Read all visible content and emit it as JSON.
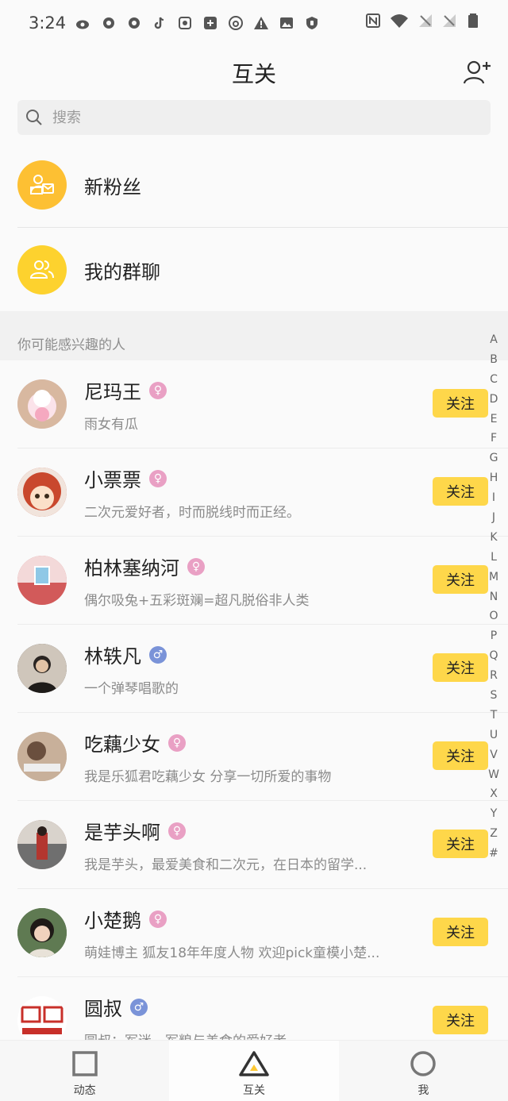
{
  "status_bar": {
    "time": "3:24",
    "left_icons": [
      "weibo-icon",
      "app-icon",
      "app-icon",
      "tiktok-icon",
      "app-icon",
      "plus-icon",
      "netease-icon",
      "warning-icon",
      "image-icon",
      "shield-icon"
    ],
    "right_icons": [
      "nfc-icon",
      "wifi-icon",
      "no-signal-icon",
      "no-signal-icon",
      "battery-icon"
    ]
  },
  "header": {
    "title": "互关"
  },
  "search": {
    "placeholder": "搜索"
  },
  "entries": [
    {
      "label": "新粉丝",
      "icon": "new-fans-icon",
      "color": "#fdc033"
    },
    {
      "label": "我的群聊",
      "icon": "group-chat-icon",
      "color": "#fdd22e"
    }
  ],
  "section_title": "你可能感兴趣的人",
  "follow_label": "关注",
  "users": [
    {
      "name": "尼玛王",
      "gender": "female",
      "bio": "雨女有瓜",
      "avatar_color": "#e8c9cf"
    },
    {
      "name": "小票票",
      "gender": "female",
      "bio": "二次元爱好者，时而脱线时而正经。",
      "avatar_color": "#c9482d"
    },
    {
      "name": "柏林塞纳河",
      "gender": "female",
      "bio": "偶尔吸兔+五彩斑斓=超凡脱俗非人类",
      "avatar_color": "#d46a6a"
    },
    {
      "name": "林轶凡",
      "gender": "male",
      "bio": "一个弹琴唱歌的",
      "avatar_color": "#3b3530"
    },
    {
      "name": "吃藕少女",
      "gender": "female",
      "bio": "我是乐狐君吃藕少女 分享一切所爱的事物",
      "avatar_color": "#b99c84"
    },
    {
      "name": "是芋头啊",
      "gender": "female",
      "bio": "我是芋头，最爱美食和二次元，在日本的留学...",
      "avatar_color": "#8f5a4e"
    },
    {
      "name": "小楚鹅",
      "gender": "female",
      "bio": "萌娃博主 狐友18年年度人物 欢迎pick童模小楚...",
      "avatar_color": "#4a5a3a"
    },
    {
      "name": "圆叔",
      "gender": "male",
      "bio": "圆叔：军迷，军粮与美食的爱好者",
      "avatar_color": "#ffffff"
    }
  ],
  "gender_symbols": {
    "female": "♀",
    "male": "♂"
  },
  "alphabet": [
    "A",
    "B",
    "C",
    "D",
    "E",
    "F",
    "G",
    "H",
    "I",
    "J",
    "K",
    "L",
    "M",
    "N",
    "O",
    "P",
    "Q",
    "R",
    "S",
    "T",
    "U",
    "V",
    "W",
    "X",
    "Y",
    "Z",
    "#"
  ],
  "nav": [
    {
      "label": "动态",
      "icon": "square-icon"
    },
    {
      "label": "互关",
      "icon": "triangle-icon",
      "active": true
    },
    {
      "label": "我",
      "icon": "circle-icon"
    }
  ]
}
